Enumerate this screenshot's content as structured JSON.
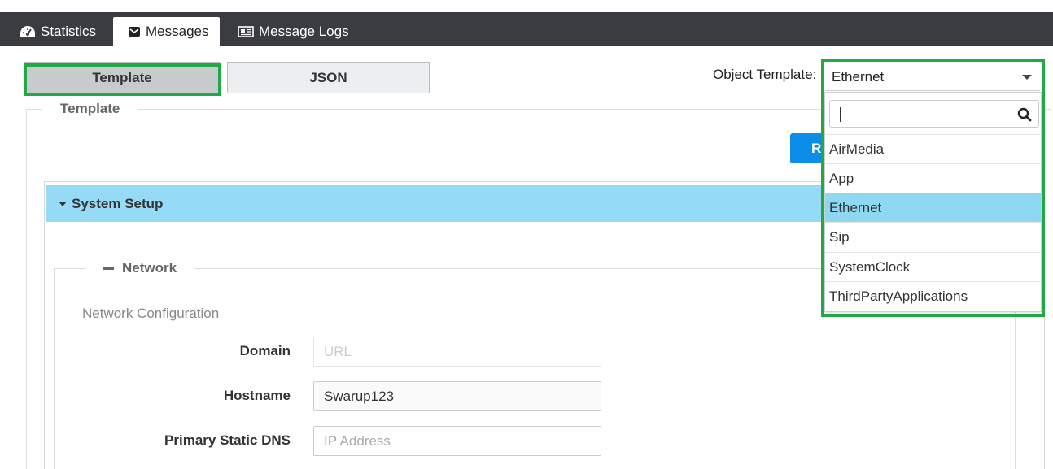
{
  "tabs": [
    {
      "label": "Statistics",
      "icon": "dashboard-icon",
      "active": false
    },
    {
      "label": "Messages",
      "icon": "envelope-icon",
      "active": true
    },
    {
      "label": "Message Logs",
      "icon": "newspaper-icon",
      "active": false
    }
  ],
  "view_toggle": {
    "template_label": "Template",
    "json_label": "JSON"
  },
  "object_template": {
    "label": "Object Template:",
    "selected": "Ethernet",
    "search_value": "",
    "options": [
      "AirMedia",
      "App",
      "Ethernet",
      "Sip",
      "SystemClock",
      "ThirdPartyApplications"
    ]
  },
  "template_section": {
    "legend": "Template",
    "action_button_label": "R"
  },
  "system_setup": {
    "title": "System Setup"
  },
  "network": {
    "legend": "Network",
    "subtitle": "Network Configuration",
    "fields": {
      "domain": {
        "label": "Domain",
        "value": "",
        "placeholder": "URL"
      },
      "hostname": {
        "label": "Hostname",
        "value": "Swarup123",
        "placeholder": ""
      },
      "primary_dns": {
        "label": "Primary Static DNS",
        "value": "",
        "placeholder": "IP Address"
      }
    }
  },
  "colors": {
    "tabbar": "#3a3c42",
    "highlight": "#22a845",
    "panel_header": "#95dbf5",
    "selected_option": "#8fd8f2",
    "primary_button": "#0a8ee8"
  }
}
